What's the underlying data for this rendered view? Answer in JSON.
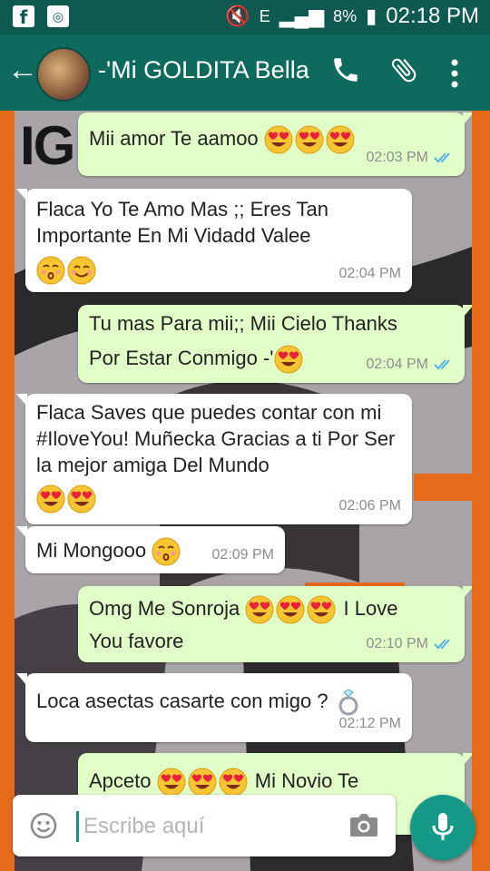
{
  "status_bar": {
    "left_icons": [
      "facebook-icon",
      "instagram-icon"
    ],
    "battery": "8%",
    "time": "02:18 PM"
  },
  "app_bar": {
    "contact_name": "-'Mi GOLDITA Bella",
    "color": "#0f6a5e"
  },
  "background": {
    "logo_text": "IG"
  },
  "messages": [
    {
      "dir": "out",
      "text": "Mii amor Te aamoo",
      "emoji": [
        "heart-eyes",
        "heart-eyes",
        "heart-eyes"
      ],
      "time": "02:03 PM",
      "read": true
    },
    {
      "dir": "in",
      "text": "Flaca Yo Te Amo Mas ;; Eres Tan Importante En Mi Vidadd Valee",
      "emoji": [
        "kissing",
        "smiling"
      ],
      "time": "02:04 PM"
    },
    {
      "dir": "out",
      "text_line1": "Tu mas Para mii;; Mii Cielo Thanks",
      "text_line2": "Por Estar Conmigo -'",
      "emoji": [
        "heart-eyes"
      ],
      "time": "02:04 PM",
      "read": true
    },
    {
      "dir": "in",
      "text": "Flaca Saves que puedes contar con mi #IloveYou! Muñecka Gracias a ti Por Ser la mejor amiga Del Mundo",
      "emoji": [
        "heart-eyes",
        "heart-eyes"
      ],
      "time": "02:06 PM"
    },
    {
      "dir": "in",
      "text": "Mi Mongooo",
      "emoji": [
        "kissing"
      ],
      "time": "02:09 PM"
    },
    {
      "dir": "out",
      "text_before": "Omg Me Sonroja",
      "emoji": [
        "heart-eyes",
        "heart-eyes",
        "heart-eyes"
      ],
      "text_after": "I Love",
      "text_line2": "You favore",
      "time": "02:10 PM",
      "read": true
    },
    {
      "dir": "in",
      "text": "Loca asectas casarte con migo ?",
      "emoji": [
        "ring"
      ],
      "time": "02:12 PM"
    },
    {
      "dir": "out",
      "text_before": "Apceto",
      "emoji": [
        "heart-eyes",
        "heart-eyes",
        "heart-eyes"
      ],
      "text_after": "Mi Novio Te"
    }
  ],
  "input": {
    "placeholder": "Escribe aquí",
    "value": ""
  },
  "colors": {
    "outgoing_bubble": "#e2fec8",
    "incoming_bubble": "#ffffff",
    "read_ticks": "#4fb3e8",
    "accent": "#149a87"
  }
}
